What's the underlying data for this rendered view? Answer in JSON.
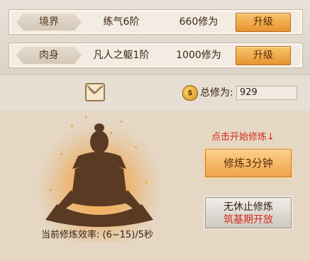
{
  "rows": [
    {
      "tag": "境界",
      "name": "练气6阶",
      "req": "660修为",
      "button": "升级"
    },
    {
      "tag": "肉身",
      "name": "凡人之躯1阶",
      "req": "1000修为",
      "button": "升级"
    }
  ],
  "status": {
    "total_label": "总修为:",
    "total_value": "929",
    "mail_icon": "envelope-icon",
    "money_icon": "money-bag-icon"
  },
  "cultivation": {
    "hint": "点击开始修炼↓",
    "train_button": "修炼3分钟",
    "endless_button_line1": "无休止修炼",
    "endless_button_line2": "筑基期开放",
    "efficiency": "当前修炼效率:  (6~15)/5秒"
  },
  "colors": {
    "accent": "#ef9a3a",
    "warning": "#d62a1a"
  }
}
